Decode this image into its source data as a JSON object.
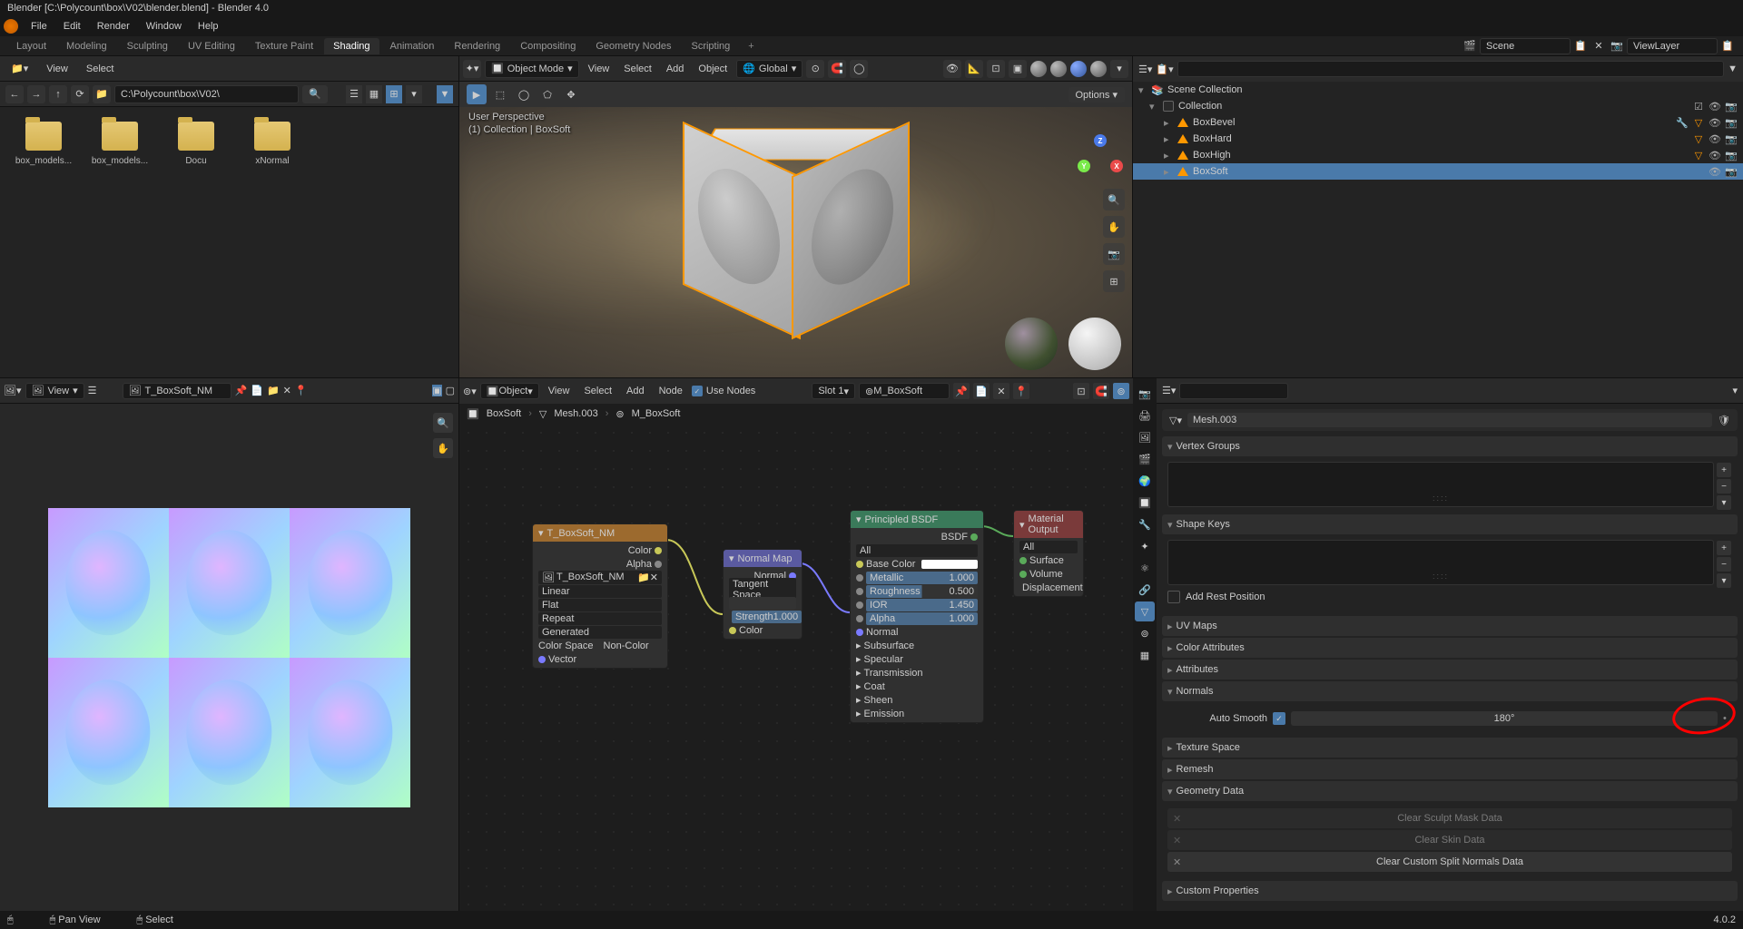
{
  "title": "Blender [C:\\Polycount\\box\\V02\\blender.blend] - Blender 4.0",
  "menubar": [
    "File",
    "Edit",
    "Render",
    "Window",
    "Help"
  ],
  "workspaces": {
    "tabs": [
      "Layout",
      "Modeling",
      "Sculpting",
      "UV Editing",
      "Texture Paint",
      "Shading",
      "Animation",
      "Rendering",
      "Compositing",
      "Geometry Nodes",
      "Scripting"
    ],
    "active": "Shading",
    "scene": "Scene",
    "view_layer": "ViewLayer"
  },
  "file_browser": {
    "menus": [
      "View",
      "Select"
    ],
    "path": "C:\\Polycount\\box\\V02\\",
    "folders": [
      "box_models...",
      "box_models...",
      "Docu",
      "xNormal"
    ]
  },
  "viewport": {
    "mode": "Object Mode",
    "menus": [
      "View",
      "Select",
      "Add",
      "Object"
    ],
    "orientation": "Global",
    "options": "Options",
    "overlay_line1": "User Perspective",
    "overlay_line2": "(1) Collection | BoxSoft"
  },
  "outliner": {
    "root": "Scene Collection",
    "collection": "Collection",
    "items": [
      {
        "name": "BoxBevel",
        "sel": false
      },
      {
        "name": "BoxHard",
        "sel": false
      },
      {
        "name": "BoxHigh",
        "sel": false
      },
      {
        "name": "BoxSoft",
        "sel": true
      }
    ]
  },
  "properties": {
    "mesh_name": "Mesh.003",
    "panels": {
      "vertex_groups": "Vertex Groups",
      "shape_keys": "Shape Keys",
      "add_rest": "Add Rest Position",
      "uv_maps": "UV Maps",
      "color_attr": "Color Attributes",
      "attributes": "Attributes",
      "normals": "Normals",
      "auto_smooth": "Auto Smooth",
      "auto_smooth_angle": "180°",
      "texture_space": "Texture Space",
      "remesh": "Remesh",
      "geom_data": "Geometry Data",
      "clear_sculpt": "Clear Sculpt Mask Data",
      "clear_skin": "Clear Skin Data",
      "clear_normals": "Clear Custom Split Normals Data",
      "custom_props": "Custom Properties"
    }
  },
  "image_editor": {
    "menus": [
      "View"
    ],
    "image_name": "T_BoxSoft_NM"
  },
  "node_editor": {
    "mode": "Object",
    "menus": [
      "View",
      "Select",
      "Add",
      "Node"
    ],
    "use_nodes": "Use Nodes",
    "slot": "Slot 1",
    "material": "M_BoxSoft",
    "breadcrumb": [
      "BoxSoft",
      "Mesh.003",
      "M_BoxSoft"
    ],
    "nodes": {
      "tex": {
        "title": "T_BoxSoft_NM",
        "out_color": "Color",
        "out_alpha": "Alpha",
        "image": "T_BoxSoft_NM",
        "interp": "Linear",
        "proj": "Flat",
        "wrap": "Repeat",
        "source": "Generated",
        "cs_label": "Color Space",
        "cs_value": "Non-Color",
        "in_vector": "Vector"
      },
      "nmap": {
        "title": "Normal Map",
        "out_normal": "Normal",
        "space": "Tangent Space",
        "strength": "Strength",
        "strength_v": "1.000",
        "in_color": "Color"
      },
      "bsdf": {
        "title": "Principled BSDF",
        "out": "BSDF",
        "dist": "All",
        "base_color": "Base Color",
        "metallic": "Metallic",
        "metallic_v": "1.000",
        "roughness": "Roughness",
        "roughness_v": "0.500",
        "ior": "IOR",
        "ior_v": "1.450",
        "alpha": "Alpha",
        "alpha_v": "1.000",
        "normal": "Normal",
        "expanders": [
          "Subsurface",
          "Specular",
          "Transmission",
          "Coat",
          "Sheen",
          "Emission"
        ]
      },
      "out": {
        "title": "Material Output",
        "target": "All",
        "surface": "Surface",
        "volume": "Volume",
        "disp": "Displacement"
      }
    }
  },
  "status_bar": {
    "pan": "Pan View",
    "select": "Select",
    "version": "4.0.2"
  }
}
